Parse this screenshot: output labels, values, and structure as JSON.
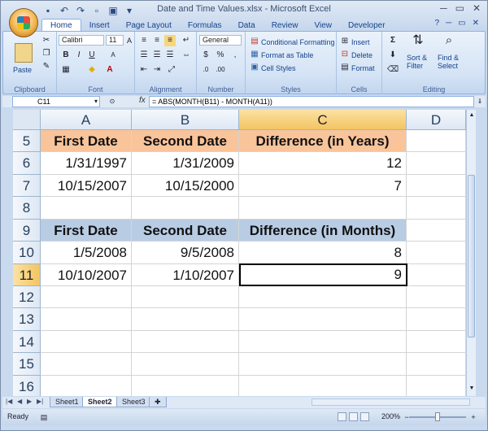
{
  "window": {
    "title": "Date and Time Values.xlsx - Microsoft Excel"
  },
  "quick_access": {
    "icons": [
      "save-icon",
      "undo-icon",
      "redo-icon",
      "new-icon",
      "print-icon",
      "dropdown-icon"
    ]
  },
  "tabs": [
    "Home",
    "Insert",
    "Page Layout",
    "Formulas",
    "Data",
    "Review",
    "View",
    "Developer"
  ],
  "active_tab": "Home",
  "ribbon": {
    "clipboard": {
      "label": "Clipboard",
      "paste": "Paste"
    },
    "font": {
      "label": "Font",
      "name": "Calibri",
      "size": "11",
      "bold": "B",
      "italic": "I",
      "underline": "U",
      "grow": "A",
      "shrink": "A",
      "font_color": "A"
    },
    "alignment": {
      "label": "Alignment"
    },
    "number": {
      "label": "Number",
      "format": "General",
      "currency": "$",
      "percent": "%",
      "comma": ","
    },
    "styles": {
      "label": "Styles",
      "conditional": "Conditional Formatting",
      "format_table": "Format as Table",
      "cell_styles": "Cell Styles"
    },
    "cells": {
      "label": "Cells",
      "insert": "Insert",
      "delete": "Delete",
      "format": "Format"
    },
    "editing": {
      "label": "Editing",
      "sigma": "Σ",
      "sort": "Sort &",
      "filter": "Filter",
      "find": "Find &",
      "select": "Select"
    }
  },
  "formula_bar": {
    "name_box": "C11",
    "fx": "fx",
    "formula": "= ABS(MONTH(B11) - MONTH(A11))"
  },
  "grid": {
    "columns": [
      "A",
      "B",
      "C",
      "D"
    ],
    "selected_column": "C",
    "rows": [
      "5",
      "6",
      "7",
      "8",
      "9",
      "10",
      "11",
      "12",
      "13",
      "14",
      "15",
      "16"
    ],
    "selected_row": "11",
    "cells": {
      "r5": [
        "First Date",
        "Second Date",
        "Difference (in Years)"
      ],
      "r6": [
        "1/31/1997",
        "1/31/2009",
        "12"
      ],
      "r7": [
        "10/15/2007",
        "10/15/2000",
        "7"
      ],
      "r9": [
        "First Date",
        "Second Date",
        "Difference (in Months)"
      ],
      "r10": [
        "1/5/2008",
        "9/5/2008",
        "8"
      ],
      "r11": [
        "10/10/2007",
        "1/10/2007",
        "9"
      ]
    }
  },
  "sheets": [
    "Sheet1",
    "Sheet2",
    "Sheet3"
  ],
  "active_sheet": "Sheet2",
  "status": {
    "ready": "Ready",
    "zoom": "200%"
  }
}
